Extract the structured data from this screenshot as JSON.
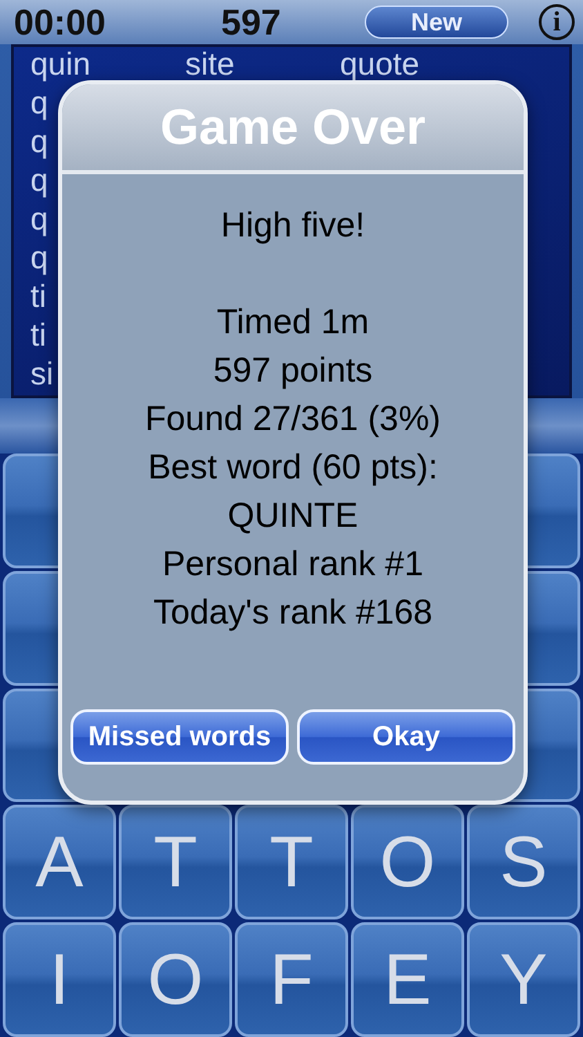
{
  "top_bar": {
    "timer": "00:00",
    "score": "597",
    "new_button": "New",
    "info_button": "i"
  },
  "found_words": {
    "columns": [
      [
        "quin",
        "q",
        "q",
        "q",
        "q",
        "q",
        "ti",
        "ti",
        "si"
      ],
      [
        "site"
      ],
      [
        "quote"
      ]
    ]
  },
  "board": {
    "rows": [
      [
        {
          "kind": "covered"
        },
        {
          "kind": "covered"
        }
      ],
      [
        {
          "kind": "covered"
        },
        {
          "kind": "covered"
        }
      ],
      [
        {
          "kind": "covered"
        },
        {
          "kind": "covered"
        }
      ],
      [
        {
          "kind": "letter",
          "letter": "A"
        },
        {
          "kind": "letter",
          "letter": "T"
        },
        {
          "kind": "letter",
          "letter": "T"
        },
        {
          "kind": "letter",
          "letter": "O"
        },
        {
          "kind": "letter",
          "letter": "S"
        }
      ],
      [
        {
          "kind": "letter",
          "letter": "I"
        },
        {
          "kind": "letter",
          "letter": "O"
        },
        {
          "kind": "letter",
          "letter": "F"
        },
        {
          "kind": "letter",
          "letter": "E"
        },
        {
          "kind": "letter",
          "letter": "Y"
        }
      ]
    ]
  },
  "dialog": {
    "title": "Game Over",
    "message": [
      [
        "High five!"
      ],
      [
        "Timed 1m",
        "597 points",
        "Found 27/361 (3%)",
        "Best word (60 pts):",
        "QUINTE",
        "Personal rank #1",
        "Today's rank #168"
      ]
    ],
    "buttons": [
      "Missed words",
      "Okay"
    ]
  }
}
